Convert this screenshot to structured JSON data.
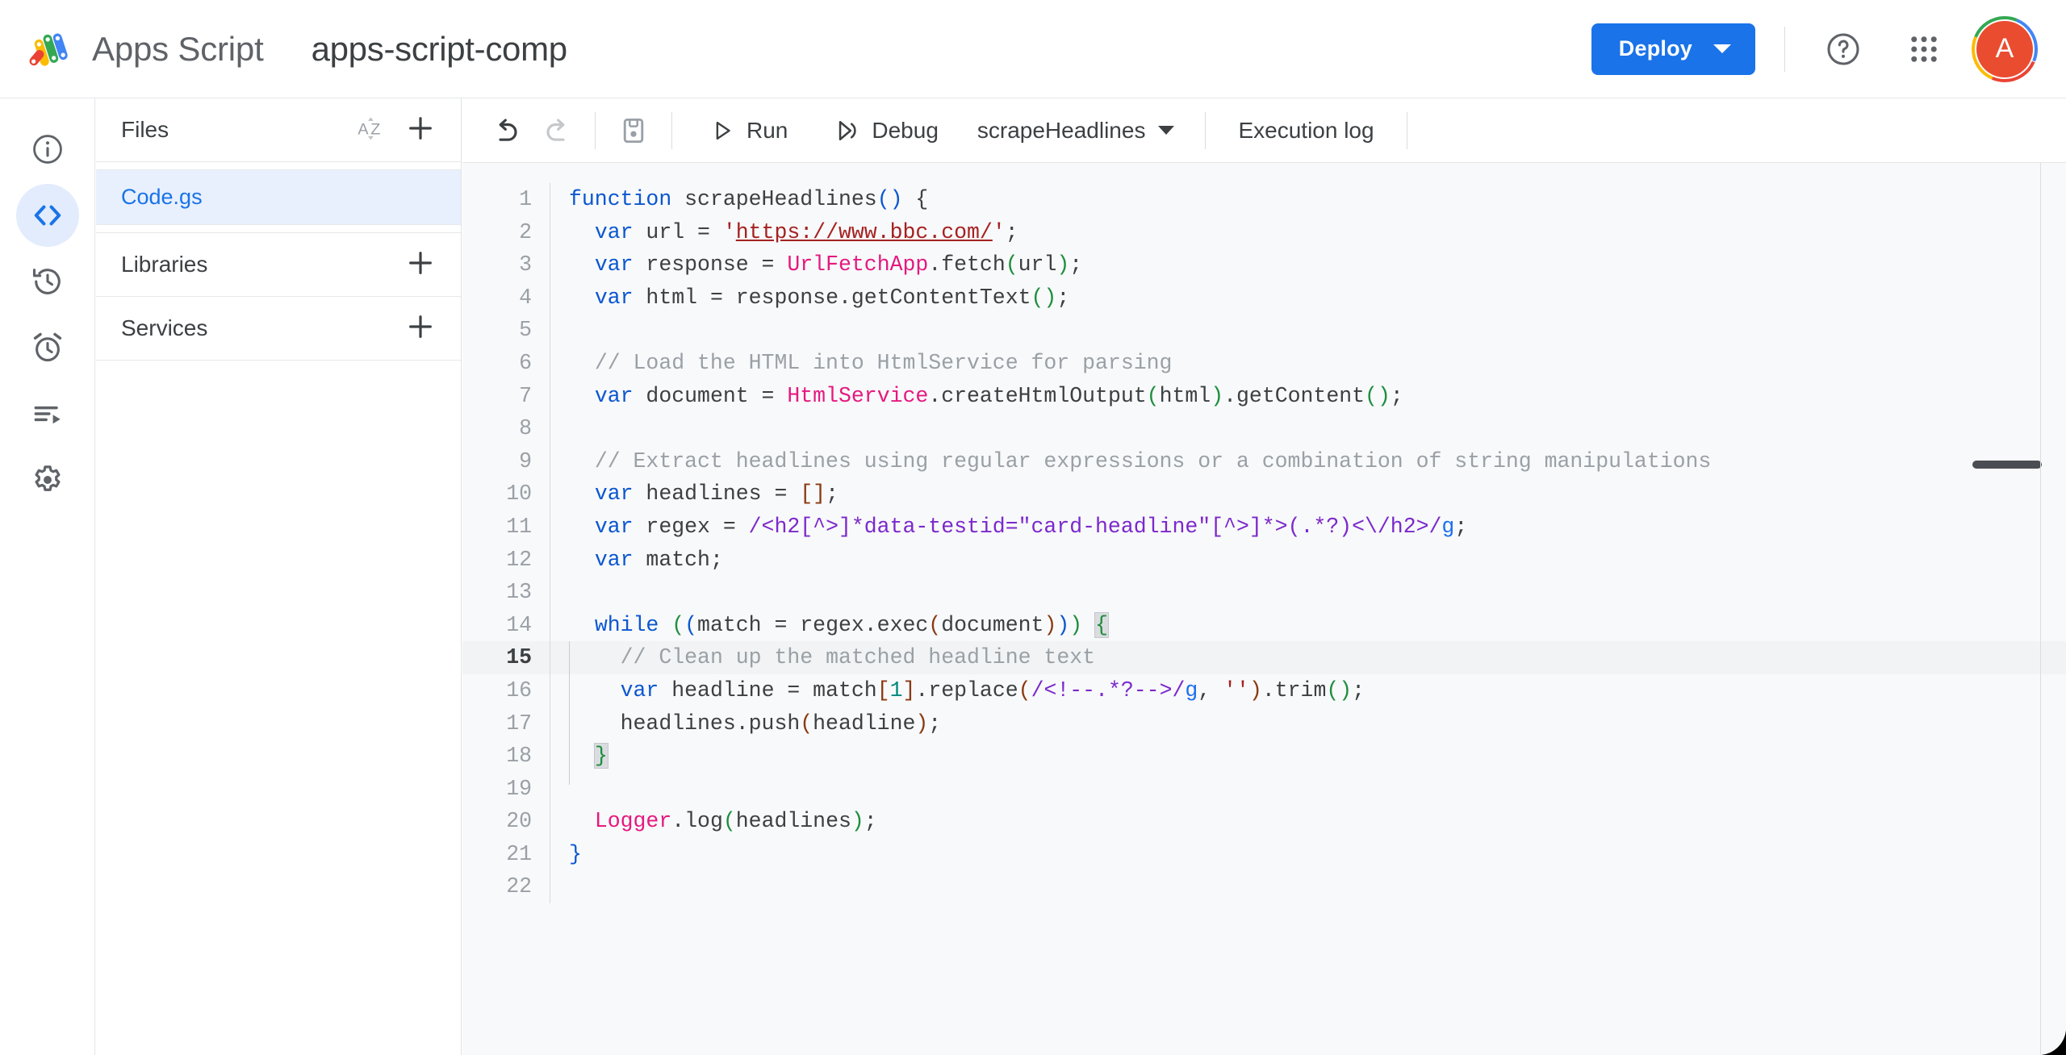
{
  "header": {
    "brand_name": "Apps Script",
    "project_title": "apps-script-comp",
    "deploy_label": "Deploy",
    "help_icon": "help-circle-icon",
    "apps_icon": "apps-grid-icon",
    "avatar_letter": "A",
    "accent_color": "#1a73e8",
    "avatar_color": "#ea4c30"
  },
  "rail": {
    "items": [
      {
        "name": "overview",
        "icon": "info-circle-icon",
        "active": false
      },
      {
        "name": "editor",
        "icon": "code-brackets-icon",
        "active": true
      },
      {
        "name": "triggers-history",
        "icon": "history-clock-icon",
        "active": false
      },
      {
        "name": "triggers",
        "icon": "alarm-clock-icon",
        "active": false
      },
      {
        "name": "executions",
        "icon": "executions-list-icon",
        "active": false
      },
      {
        "name": "project-settings",
        "icon": "gear-icon",
        "active": false
      }
    ]
  },
  "files_panel": {
    "files_label": "Files",
    "sort_icon": "sort-az-icon",
    "add_icon": "plus-icon",
    "file_items": [
      {
        "name": "Code.gs",
        "selected": true
      }
    ],
    "libraries_label": "Libraries",
    "services_label": "Services"
  },
  "toolbar": {
    "undo_icon": "undo-arrow-icon",
    "redo_icon": "redo-arrow-icon",
    "save_icon": "save-disk-icon",
    "run_label": "Run",
    "run_icon": "play-triangle-icon",
    "debug_label": "Debug",
    "debug_icon": "debug-step-icon",
    "function_selected": "scrapeHeadlines",
    "execution_log_label": "Execution log"
  },
  "editor": {
    "active_line": 15,
    "total_lines": 22,
    "language": "javascript",
    "code_text": "function scrapeHeadlines() {\n  var url = 'https://www.bbc.com/';\n  var response = UrlFetchApp.fetch(url);\n  var html = response.getContentText();\n\n  // Load the HTML into HtmlService for parsing\n  var document = HtmlService.createHtmlOutput(html).getContent();\n\n  // Extract headlines using regular expressions or a combination of string manipulations\n  var headlines = [];\n  var regex = /<h2[^>]*data-testid=\"card-headline\"[^>]*>(.*?)<\\/h2>/g;\n  var match;\n\n  while ((match = regex.exec(document))) {\n    // Clean up the matched headline text\n    var headline = match[1].replace(/<!--.*?-->/g, '').trim();\n    headlines.push(headline);\n  }\n\n  Logger.log(headlines);\n}\n",
    "lines": [
      {
        "n": 1,
        "text": "function scrapeHeadlines() {"
      },
      {
        "n": 2,
        "text": "  var url = 'https://www.bbc.com/';"
      },
      {
        "n": 3,
        "text": "  var response = UrlFetchApp.fetch(url);"
      },
      {
        "n": 4,
        "text": "  var html = response.getContentText();"
      },
      {
        "n": 5,
        "text": ""
      },
      {
        "n": 6,
        "text": "  // Load the HTML into HtmlService for parsing"
      },
      {
        "n": 7,
        "text": "  var document = HtmlService.createHtmlOutput(html).getContent();"
      },
      {
        "n": 8,
        "text": ""
      },
      {
        "n": 9,
        "text": "  // Extract headlines using regular expressions or a combination of string manipulations"
      },
      {
        "n": 10,
        "text": "  var headlines = [];"
      },
      {
        "n": 11,
        "text": "  var regex = /<h2[^>]*data-testid=\"card-headline\"[^>]*>(.*?)<\\/h2>/g;"
      },
      {
        "n": 12,
        "text": "  var match;"
      },
      {
        "n": 13,
        "text": ""
      },
      {
        "n": 14,
        "text": "  while ((match = regex.exec(document))) {"
      },
      {
        "n": 15,
        "text": "    // Clean up the matched headline text"
      },
      {
        "n": 16,
        "text": "    var headline = match[1].replace(/<!--.*?-->/g, '').trim();"
      },
      {
        "n": 17,
        "text": "    headlines.push(headline);"
      },
      {
        "n": 18,
        "text": "  }"
      },
      {
        "n": 19,
        "text": ""
      },
      {
        "n": 20,
        "text": "  Logger.log(headlines);"
      },
      {
        "n": 21,
        "text": "}"
      },
      {
        "n": 22,
        "text": ""
      }
    ]
  }
}
